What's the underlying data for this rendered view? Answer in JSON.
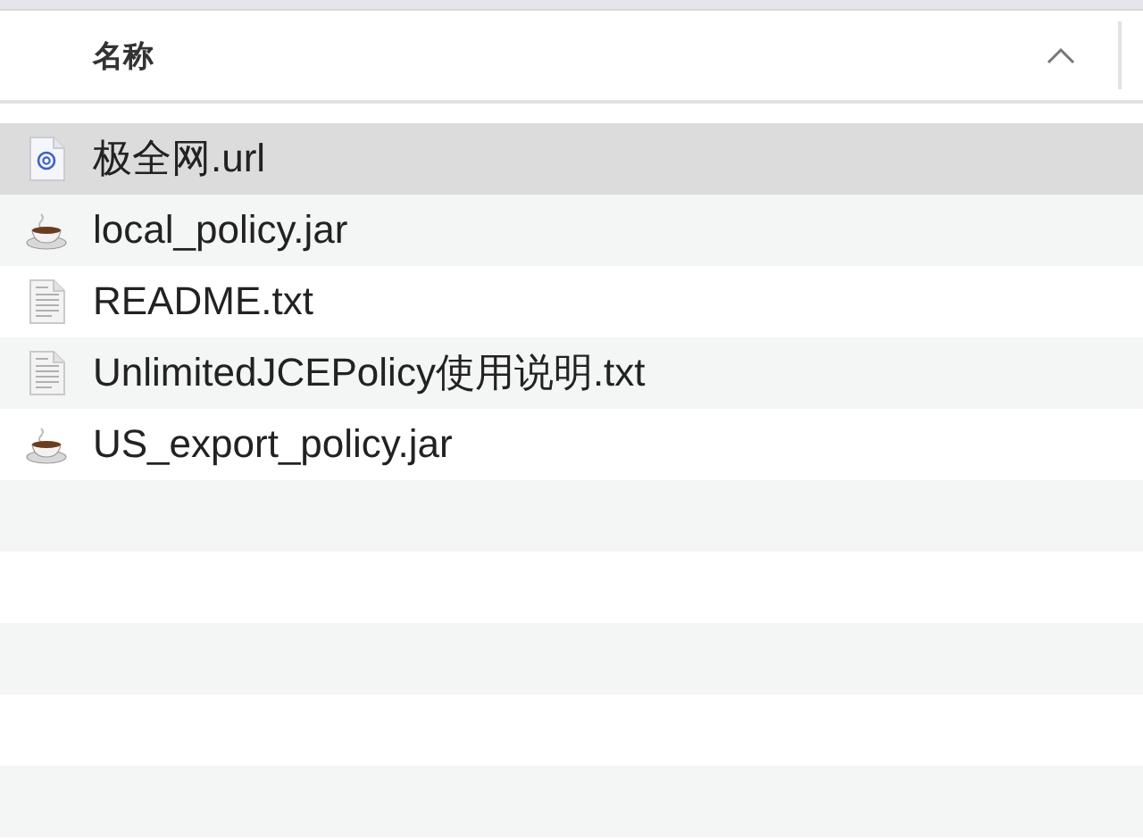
{
  "column_header": {
    "label": "名称",
    "sort_ascending": true
  },
  "files": [
    {
      "name": "极全网.url",
      "kind": "url",
      "selected": true
    },
    {
      "name": "local_policy.jar",
      "kind": "jar",
      "selected": false
    },
    {
      "name": "README.txt",
      "kind": "txt",
      "selected": false
    },
    {
      "name": "UnlimitedJCEPolicy使用说明.txt",
      "kind": "txt",
      "selected": false
    },
    {
      "name": "US_export_policy.jar",
      "kind": "jar",
      "selected": false
    }
  ]
}
